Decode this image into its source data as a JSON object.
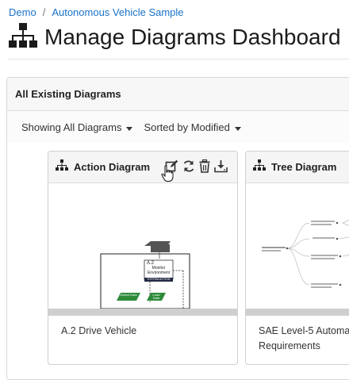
{
  "breadcrumb": {
    "items": [
      "Demo",
      "Autonomous Vehicle Sample"
    ],
    "separator": "/"
  },
  "page": {
    "title": "Manage Diagrams Dashboard",
    "icon": "sitemap-icon"
  },
  "panel": {
    "title": "All Existing Diagrams",
    "filter_label": "Showing All Diagrams",
    "sort_label": "Sorted by Modified"
  },
  "cards": [
    {
      "title": "Action Diagram",
      "caption": "A.2 Drive Vehicle",
      "actions": [
        "edit-icon",
        "refresh-icon",
        "trash-icon",
        "download-icon"
      ]
    },
    {
      "title": "Tree Diagram",
      "caption_line1": "SAE Level-5 Automa",
      "caption_line2": "Requirements"
    }
  ],
  "thumbnail": {
    "action_id": "A.2",
    "action_line1": "Monitor",
    "action_line2": "Environment",
    "action_footer": "SYSTEM-ACTION",
    "pill_left": "Detect Data",
    "pill_right": "Load Data"
  },
  "colors": {
    "link": "#1a73c8",
    "pill": "#2e8b3a",
    "dark_block": "#222a44"
  }
}
